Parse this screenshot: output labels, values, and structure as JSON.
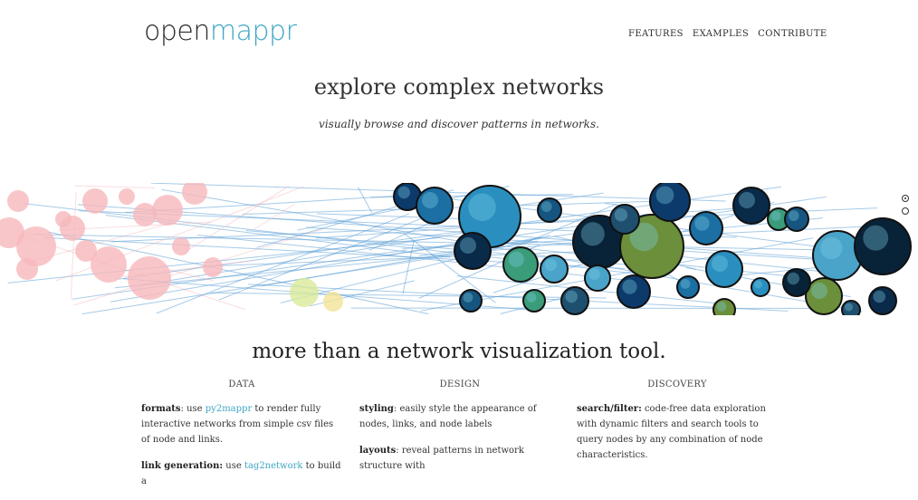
{
  "header": {
    "logo_part1": "open",
    "logo_part2": "mappr",
    "nav": [
      "FEATURES",
      "EXAMPLES",
      "CONTRIBUTE"
    ]
  },
  "hero": {
    "title": "explore complex networks",
    "subtitle": "visually browse and discover patterns in networks."
  },
  "section": {
    "title": "more than a network visualization tool."
  },
  "columns": [
    {
      "heading": "DATA",
      "items": [
        {
          "label": "formats",
          "sep": ": use ",
          "link": "py2mappr",
          "rest": " to render fully interactive networks from simple csv files of node and links."
        },
        {
          "label": "link generation:",
          "sep": " use ",
          "link": "tag2network",
          "rest": " to build a"
        }
      ]
    },
    {
      "heading": "DESIGN",
      "items": [
        {
          "label": "styling",
          "rest": ": easily style the appearance of nodes, links, and node labels"
        },
        {
          "label": "layouts",
          "rest": ": reveal patterns in network structure with"
        }
      ]
    },
    {
      "heading": "DISCOVERY",
      "items": [
        {
          "label": "search/filter:",
          "rest": " code-free data exploration with dynamic filters and search tools to query nodes by any combination of node characteristics."
        }
      ]
    }
  ],
  "colors": {
    "accent": "#3fa7c5",
    "bubble_pink": "#f6b8bc",
    "edge_blue": "#5b9fd6"
  }
}
